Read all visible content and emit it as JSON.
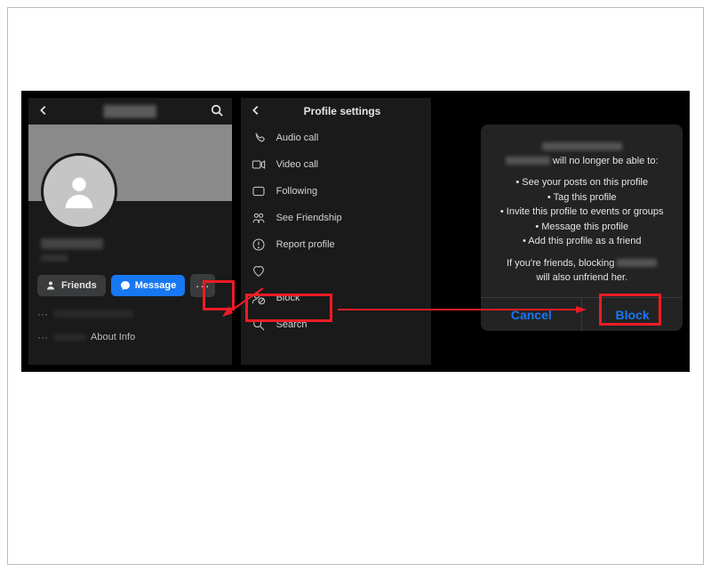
{
  "colors": {
    "accent": "#1877f2",
    "highlight": "#ec1c24",
    "bg_dark": "#1a1a1a"
  },
  "panel1": {
    "header_title": "███████",
    "friends_label": "Friends",
    "message_label": "Message",
    "more_label": "···",
    "about_label": "About Info"
  },
  "panel2": {
    "title": "Profile settings",
    "items": [
      {
        "label": "Audio call",
        "icon": "phone-icon"
      },
      {
        "label": "Video call",
        "icon": "video-icon"
      },
      {
        "label": "Following",
        "icon": "following-icon"
      },
      {
        "label": "See Friendship",
        "icon": "friendship-icon"
      },
      {
        "label": "Report profile",
        "icon": "report-icon"
      },
      {
        "label": "",
        "icon": "heart-icon"
      },
      {
        "label": "Block",
        "icon": "block-icon"
      },
      {
        "label": "Search",
        "icon": "search-icon"
      }
    ]
  },
  "panel3": {
    "intro_name": "██████",
    "intro_suffix": " will no longer be able to:",
    "list": [
      "See your posts on this profile",
      "Tag this profile",
      "Invite this profile to events or groups",
      "Message this profile",
      "Add this profile as a friend"
    ],
    "outro_prefix": "If you're friends, blocking ",
    "outro_name": "██████",
    "outro_suffix": "will also unfriend her.",
    "cancel_label": "Cancel",
    "block_label": "Block"
  }
}
